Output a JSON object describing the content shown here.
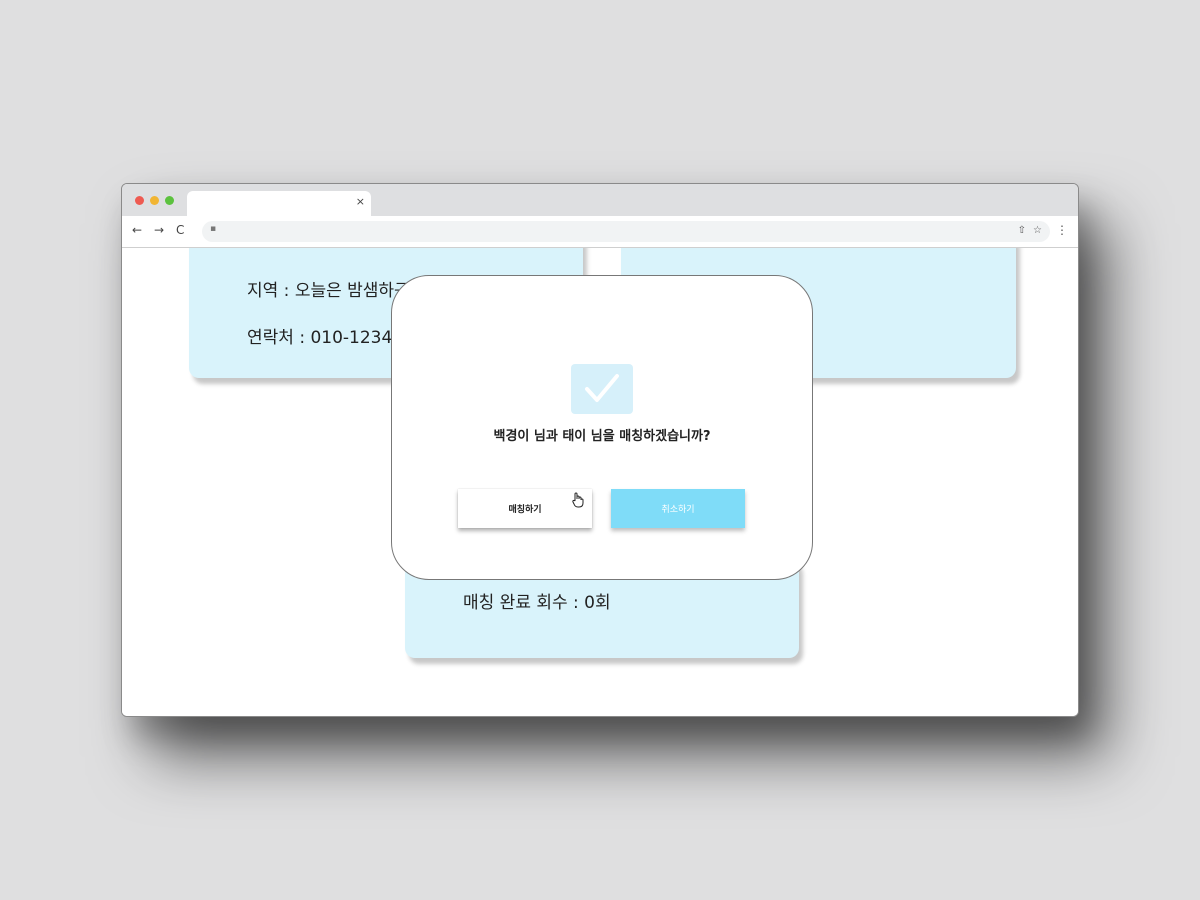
{
  "browser": {
    "tab_close": "×",
    "nav": {
      "back": "←",
      "forward": "→",
      "reload": "C"
    },
    "url_icons": {
      "lock": "lock-icon",
      "share": "share-icon",
      "star": "star-icon",
      "menu": "menu-dots-icon"
    }
  },
  "cards": {
    "left": {
      "region": "지역 : 오늘은 밤샘하구",
      "contact": "연락처 : 010-1234-5"
    },
    "bottom": {
      "match_count": "매칭 완료 회수 : 0회"
    }
  },
  "modal": {
    "icon": "check-icon",
    "message": "백경이 님과 태이 님을 매칭하겠습니까?",
    "confirm_label": "매칭하기",
    "cancel_label": "취소하기"
  },
  "colors": {
    "card_bg": "#d9f3fb",
    "cancel_button": "#7fdcf8",
    "check_bg": "#d6f0fa"
  }
}
